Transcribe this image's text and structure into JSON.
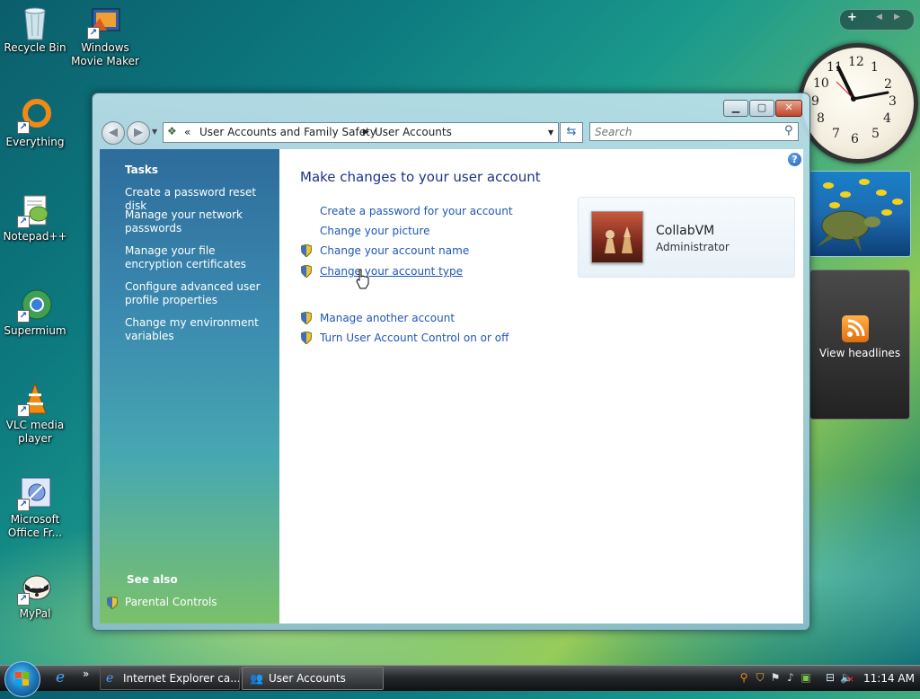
{
  "desktop": {
    "icons": [
      {
        "label": "Recycle Bin",
        "icon": "recycle-bin-icon"
      },
      {
        "label": "Windows Movie Maker",
        "icon": "movie-maker-icon"
      },
      {
        "label": "Everything",
        "icon": "everything-search-icon"
      },
      {
        "label": "Notepad++",
        "icon": "notepad-plus-plus-icon"
      },
      {
        "label": "Supermium",
        "icon": "supermium-browser-icon"
      },
      {
        "label": "VLC media player",
        "icon": "vlc-icon"
      },
      {
        "label": "Microsoft Office Fr...",
        "icon": "office-frontpage-icon"
      },
      {
        "label": "MyPal",
        "icon": "mypal-raccoon-icon"
      }
    ]
  },
  "gadgets": {
    "sidebar_add": "+",
    "clock_numbers": [
      "12",
      "1",
      "2",
      "3",
      "4",
      "5",
      "6",
      "7",
      "8",
      "9",
      "10",
      "11"
    ],
    "headlines_label": "View headlines"
  },
  "window": {
    "breadcrumb": {
      "root": "User Accounts and Family Safety",
      "current": "User Accounts",
      "prefix": "«"
    },
    "search_placeholder": "Search",
    "tasks": {
      "heading": "Tasks",
      "items": [
        "Create a password reset disk",
        "Manage your network passwords",
        "Configure advanced user profile properties",
        "Change my environment variables"
      ],
      "file_encryption": "Manage your file encryption certificates"
    },
    "see_also": {
      "heading": "See also",
      "item": "Parental Controls"
    },
    "main": {
      "title": "Make changes to your user account",
      "links": [
        "Create a password for your account",
        "Change your picture",
        "Change your account name",
        "Change your account type"
      ],
      "links2": [
        "Manage another account",
        "Turn User Account Control on or off"
      ]
    },
    "account": {
      "name": "CollabVM",
      "type": "Administrator"
    }
  },
  "taskbar": {
    "tasks": [
      "Internet Explorer ca...",
      "User Accounts"
    ],
    "time": "11:14 AM",
    "quicklaunch_more": "»"
  }
}
